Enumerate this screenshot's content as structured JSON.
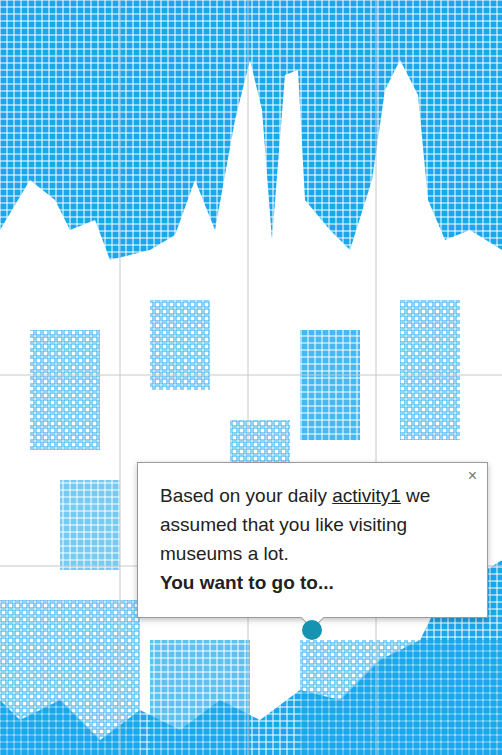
{
  "tooltip": {
    "close": "×",
    "text_before": "Based on your daily ",
    "link": "activity1",
    "text_after": " we assumed that you like visiting museums a lot.",
    "question": "You want to go to..."
  }
}
